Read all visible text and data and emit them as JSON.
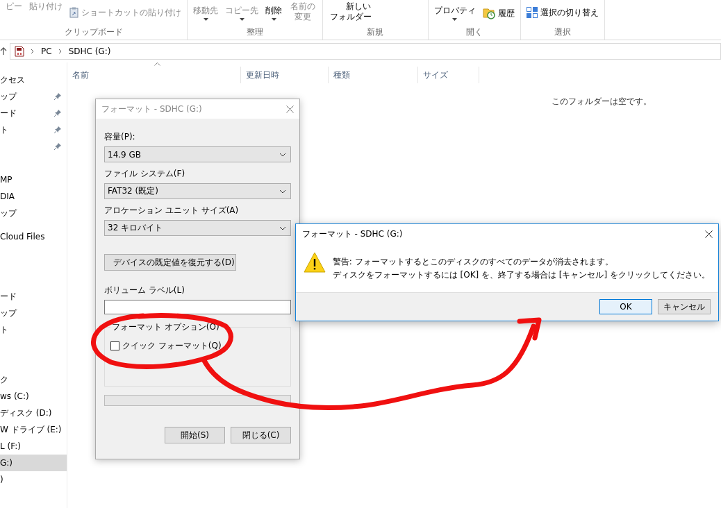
{
  "ribbon": {
    "groups": [
      {
        "label": "クリップボード",
        "items": [
          {
            "kind": "large",
            "label": "ピー",
            "disabled": true
          },
          {
            "kind": "large",
            "label": "貼り付け",
            "disabled": true
          },
          {
            "kind": "small",
            "label": "ショートカットの貼り付け",
            "disabled": true
          }
        ]
      },
      {
        "label": "整理",
        "items": [
          {
            "kind": "caret",
            "label": "移動先",
            "disabled": true
          },
          {
            "kind": "caret",
            "label": "コピー先",
            "disabled": true
          },
          {
            "kind": "caret",
            "label": "削除",
            "disabled": false
          },
          {
            "kind": "large",
            "label": "名前の変更",
            "disabled": true
          }
        ]
      },
      {
        "label": "新規",
        "items": [
          {
            "kind": "large",
            "label": "新しいフォルダー",
            "disabled": false
          }
        ]
      },
      {
        "label": "開く",
        "items": [
          {
            "kind": "caret",
            "label": "プロパティ",
            "disabled": false
          },
          {
            "kind": "small",
            "label": "履歴",
            "disabled": false
          }
        ]
      },
      {
        "label": "選択",
        "items": [
          {
            "kind": "small",
            "label": "選択の切り替え",
            "disabled": false
          }
        ]
      }
    ]
  },
  "address": {
    "breadcrumb": [
      "PC",
      "SDHC (G:)"
    ]
  },
  "sidebar": {
    "sections": [
      [
        {
          "label": "クセス",
          "pinned": false,
          "selected": false
        },
        {
          "label": "ップ",
          "pinned": true,
          "selected": false
        },
        {
          "label": "ード",
          "pinned": true,
          "selected": false
        },
        {
          "label": "ト",
          "pinned": true,
          "selected": false
        },
        {
          "pinned": true,
          "selected": false
        }
      ],
      [
        {
          "label": "MP",
          "pinned": false,
          "selected": false
        },
        {
          "label": "DIA",
          "pinned": false,
          "selected": false
        },
        {
          "label": "ップ",
          "pinned": false,
          "selected": false
        }
      ],
      [
        {
          "label": "Cloud Files",
          "pinned": false,
          "selected": false
        }
      ],
      [
        {
          "label": "ード",
          "pinned": false,
          "selected": false
        },
        {
          "label": "ップ",
          "pinned": false,
          "selected": false
        },
        {
          "label": "ト",
          "pinned": false,
          "selected": false
        }
      ],
      [
        {
          "label": "ク",
          "pinned": false,
          "selected": false
        },
        {
          "label": "ws (C:)",
          "pinned": false,
          "selected": false
        },
        {
          "label": "ディスク (D:)",
          "pinned": false,
          "selected": false
        },
        {
          "label": "W ドライブ (E:)",
          "pinned": false,
          "selected": false
        },
        {
          "label": "L (F:)",
          "pinned": false,
          "selected": false
        },
        {
          "label": "G:)",
          "pinned": false,
          "selected": true
        },
        {
          "label": ")",
          "pinned": false,
          "selected": false
        }
      ]
    ]
  },
  "file_list": {
    "columns": [
      {
        "label": "名前",
        "sorted": true
      },
      {
        "label": "更新日時",
        "sorted": false
      },
      {
        "label": "種類",
        "sorted": false
      },
      {
        "label": "サイズ",
        "sorted": false
      }
    ],
    "empty_message": "このフォルダーは空です。"
  },
  "format_dialog": {
    "title": "フォーマット - SDHC (G:)",
    "fields": [
      {
        "kind": "select",
        "label": "容量(P):",
        "value": "14.9 GB"
      },
      {
        "kind": "select",
        "label": "ファイル システム(F)",
        "value": "FAT32 (既定)"
      },
      {
        "kind": "select",
        "label": "アロケーション ユニット サイズ(A)",
        "value": "32 キロバイト"
      },
      {
        "kind": "button",
        "label": "デバイスの既定値を復元する(D)"
      },
      {
        "kind": "input",
        "label": "ボリューム ラベル(L)"
      }
    ],
    "options_label": "フォーマット オプション(O)",
    "options": [
      {
        "label": "クイック フォーマット(Q)",
        "checked": false
      }
    ],
    "progress": {
      "level": 0
    },
    "buttons": [
      "開始(S)",
      "閉じる(C)"
    ]
  },
  "message_box": {
    "title": "フォーマット - SDHC (G:)",
    "message": [
      "警告: フォーマットするとこのディスクのすべてのデータが消去されます。",
      "ディスクをフォーマットするには [OK] を、終了する場合は [キャンセル] をクリックしてください。"
    ],
    "buttons": [
      {
        "label": "OK",
        "default": true
      },
      {
        "label": "キャンセル",
        "default": false
      }
    ]
  }
}
